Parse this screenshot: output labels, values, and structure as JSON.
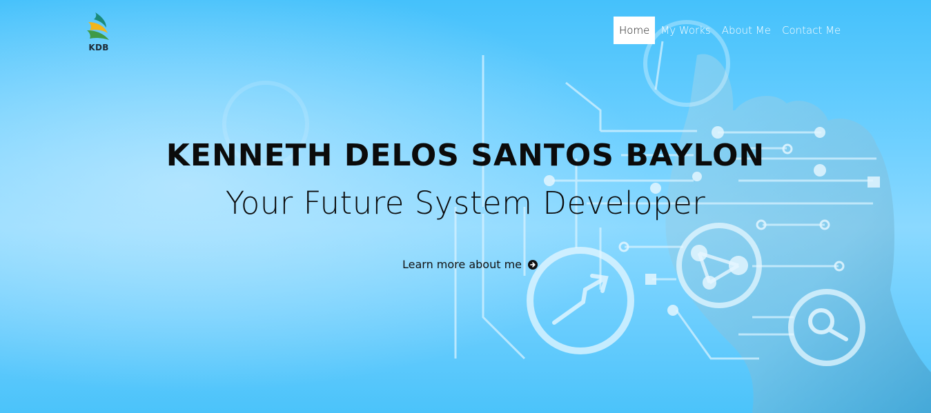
{
  "logo": {
    "text": "KDB",
    "icon": "leaf-logo-icon"
  },
  "nav": {
    "items": [
      {
        "label": "Home",
        "active": true
      },
      {
        "label": "My Works",
        "active": false
      },
      {
        "label": "About Me",
        "active": false
      },
      {
        "label": "Contact Me",
        "active": false
      }
    ]
  },
  "hero": {
    "title": "KENNETH DELOS SANTOS BAYLON",
    "subtitle": "Your Future System Developer",
    "cta_label": "Learn more about me",
    "cta_icon": "arrow-circle-right-icon"
  },
  "colors": {
    "background": "#4bc3fa",
    "nav_active_bg": "#ffffff",
    "text": "#0b0b0b"
  }
}
